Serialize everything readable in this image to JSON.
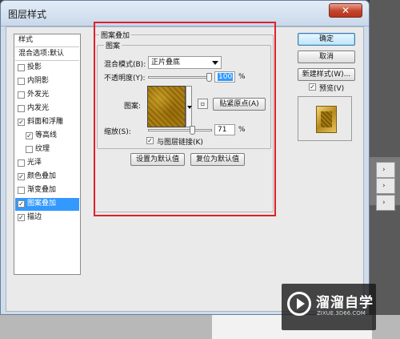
{
  "window": {
    "title": "图层样式",
    "close_label": "✕"
  },
  "style_list": {
    "header": "样式",
    "blend_default": "混合选项:默认",
    "items": [
      {
        "label": "投影",
        "checked": false
      },
      {
        "label": "内阴影",
        "checked": false
      },
      {
        "label": "外发光",
        "checked": false
      },
      {
        "label": "内发光",
        "checked": false
      },
      {
        "label": "斜面和浮雕",
        "checked": true
      },
      {
        "label": "等高线",
        "checked": true
      },
      {
        "label": "纹理",
        "checked": false
      },
      {
        "label": "光泽",
        "checked": false
      },
      {
        "label": "颜色叠加",
        "checked": true
      },
      {
        "label": "渐变叠加",
        "checked": false
      },
      {
        "label": "图案叠加",
        "checked": true
      },
      {
        "label": "描边",
        "checked": true
      }
    ],
    "selected": "图案叠加",
    "check_mark": "✓"
  },
  "panel": {
    "group_title": "图案叠加",
    "sub_title": "图案",
    "blend_mode_label": "混合模式(B):",
    "blend_mode_value": "正片叠底",
    "opacity_label": "不透明度(Y):",
    "opacity_value": "100",
    "percent": "%",
    "pattern_label": "图案:",
    "snap_button": "贴紧原点(A)",
    "scale_label": "缩放(S):",
    "scale_value": "71",
    "link_label": "与图层链接(K)",
    "link_checked": true,
    "set_default_button": "设置为默认值",
    "reset_default_button": "复位为默认值",
    "opacity_level": 1.0,
    "scale_level": 0.71
  },
  "right_buttons": {
    "ok": "确定",
    "cancel": "取消",
    "new_style": "新建样式(W)...",
    "preview": "预览(V)"
  },
  "watermark": {
    "brand": "溜溜自学",
    "url": "ZIXUE.3D66.COM"
  },
  "colors": {
    "selection": "#3399ff",
    "highlight_frame": "#e0202a",
    "dialog_frame": "#cfdcec"
  }
}
